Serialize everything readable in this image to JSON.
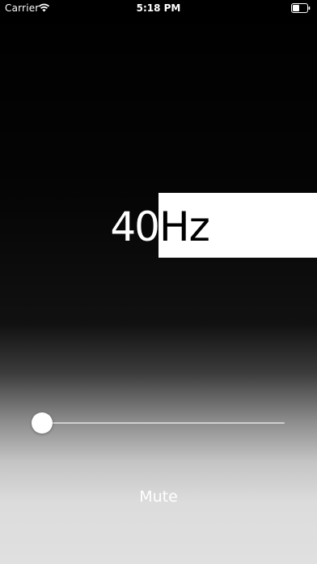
{
  "status_bar": {
    "carrier": "Carrier",
    "time": "5:18 PM",
    "wifi_icon": "wifi-icon",
    "battery_icon": "battery-icon"
  },
  "frequency": {
    "value": "40",
    "unit": "Hz"
  },
  "slider": {
    "level": 0.0
  },
  "controls": {
    "mute_label": "Mute"
  },
  "colors": {
    "accent": "#ffffff",
    "background_top": "#000000",
    "background_bottom": "#e0e0e0"
  }
}
